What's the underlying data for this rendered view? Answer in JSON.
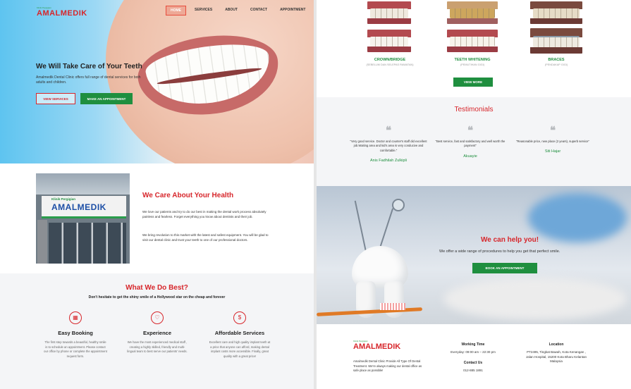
{
  "nav": {
    "logo_small": "Klinik Pergigian",
    "logo_main": "AMALMEDIK",
    "items": [
      {
        "label": "HOME",
        "active": true
      },
      {
        "label": "SERVICES",
        "active": false
      },
      {
        "label": "ABOUT",
        "active": false
      },
      {
        "label": "CONTACT",
        "active": false
      },
      {
        "label": "APPOINTMENT",
        "active": false
      }
    ]
  },
  "hero": {
    "title": "We Will Take Care of Your Teeth",
    "subtitle": "Amalmedik Dental Clinic offers full range of dental services for both adults and children.",
    "btn_services": "VIEW SERVICES",
    "btn_appointment": "MAKE AN APPOINTMENT"
  },
  "care": {
    "sign_small": "Klinik Pergigian",
    "sign_main": "AMALMEDIK",
    "title": "We Care About Your Health",
    "p1": "We love our patients and try to do our best in making the dental work process absolutely painless and fearless. Forget everything you know about dentists and their job.",
    "p2": "We bring revolution to this market with the latest and safest equipment. You will be glad to visit our dental clinic and trust your teeth to one of our professional doctors."
  },
  "best": {
    "title": "What We Do Best?",
    "subtitle": "Don't hesitate to get the shiny smile of a Hollywood star on the cheap and forever",
    "features": [
      {
        "icon": "calendar-icon",
        "glyph": "▦",
        "title": "Easy Booking",
        "text": "The first step towards a beautiful, healthy smile is to schedule an appointment. Please contact our office by phone or complete the appointment request form."
      },
      {
        "icon": "tooth-icon",
        "glyph": "♡",
        "title": "Experience",
        "text": "We have the most experienced medical staff , creating a highly skilled, friendly and multi-lingual team to best serve our patients' needs."
      },
      {
        "icon": "money-icon",
        "glyph": "$",
        "title": "Affordable Services",
        "text": "Excellent care and high quality implant teeth at a price that anyone can afford, making dental implant costs more accessible. Finally, great quality with a great price!"
      }
    ]
  },
  "gallery": {
    "items": [
      {
        "title": "CROWN/BRIDGE",
        "sub": "(SEBELUM DAN SELEPAS RAWATAN)"
      },
      {
        "title": "TEETH WHITENING",
        "sub": "(PEMUTIHAN GIGI)"
      },
      {
        "title": "BRACES",
        "sub": "(PENDAKAP GIGI)"
      }
    ],
    "view_more": "VIEW MORE"
  },
  "testimonials": {
    "title": "Testimonials",
    "items": [
      {
        "text": "\"Very good service. Doctor and counter's staff did excellent job.Waiting area and kid's area is very conducive and comfortable.\"",
        "name": "Anis Fadhilah Zulkipli"
      },
      {
        "text": "\"Best service, fast and satisfactory and well worth the payment\"",
        "name": "Akuayie"
      },
      {
        "text": "\"Reasonable price, new place (2 years), superb service\"",
        "name": "Siti Hajar"
      }
    ]
  },
  "help": {
    "title": "We can help you!",
    "subtitle": "We offer a wide range of procedures to help you get that perfect smile.",
    "button": "BOOK AN APPOINTMENT"
  },
  "footer": {
    "logo_small": "Klinik Pergigian",
    "logo_main": "AMALMEDIK",
    "desc": "Amalmedik Dental Clinic Provide All Type Of Dental Treatment. We're always making our dental office as safe place as possible!",
    "hours_title": "Working Time",
    "hours": "Everyday: 09:00 am – 22:30 pm",
    "contact_title": "Contact Us",
    "phone": "012-885 1891",
    "location_title": "Location",
    "address": "PT2495, Tingkat Bawah, Kota Kenangan , Jalan Hospital, 15200 Kota Bharu Kelantan Malaysia"
  },
  "colors": {
    "accent_red": "#d7262b",
    "brand_green": "#1f8f3f"
  }
}
